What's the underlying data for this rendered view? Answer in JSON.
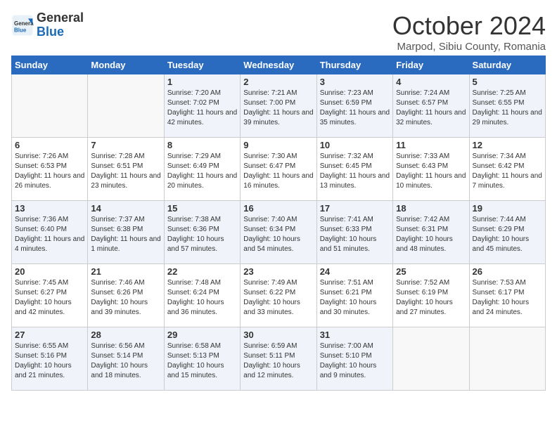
{
  "header": {
    "logo_general": "General",
    "logo_blue": "Blue",
    "month_title": "October 2024",
    "location": "Marpod, Sibiu County, Romania"
  },
  "days_of_week": [
    "Sunday",
    "Monday",
    "Tuesday",
    "Wednesday",
    "Thursday",
    "Friday",
    "Saturday"
  ],
  "weeks": [
    [
      {
        "day": "",
        "info": ""
      },
      {
        "day": "",
        "info": ""
      },
      {
        "day": "1",
        "info": "Sunrise: 7:20 AM\nSunset: 7:02 PM\nDaylight: 11 hours and 42 minutes."
      },
      {
        "day": "2",
        "info": "Sunrise: 7:21 AM\nSunset: 7:00 PM\nDaylight: 11 hours and 39 minutes."
      },
      {
        "day": "3",
        "info": "Sunrise: 7:23 AM\nSunset: 6:59 PM\nDaylight: 11 hours and 35 minutes."
      },
      {
        "day": "4",
        "info": "Sunrise: 7:24 AM\nSunset: 6:57 PM\nDaylight: 11 hours and 32 minutes."
      },
      {
        "day": "5",
        "info": "Sunrise: 7:25 AM\nSunset: 6:55 PM\nDaylight: 11 hours and 29 minutes."
      }
    ],
    [
      {
        "day": "6",
        "info": "Sunrise: 7:26 AM\nSunset: 6:53 PM\nDaylight: 11 hours and 26 minutes."
      },
      {
        "day": "7",
        "info": "Sunrise: 7:28 AM\nSunset: 6:51 PM\nDaylight: 11 hours and 23 minutes."
      },
      {
        "day": "8",
        "info": "Sunrise: 7:29 AM\nSunset: 6:49 PM\nDaylight: 11 hours and 20 minutes."
      },
      {
        "day": "9",
        "info": "Sunrise: 7:30 AM\nSunset: 6:47 PM\nDaylight: 11 hours and 16 minutes."
      },
      {
        "day": "10",
        "info": "Sunrise: 7:32 AM\nSunset: 6:45 PM\nDaylight: 11 hours and 13 minutes."
      },
      {
        "day": "11",
        "info": "Sunrise: 7:33 AM\nSunset: 6:43 PM\nDaylight: 11 hours and 10 minutes."
      },
      {
        "day": "12",
        "info": "Sunrise: 7:34 AM\nSunset: 6:42 PM\nDaylight: 11 hours and 7 minutes."
      }
    ],
    [
      {
        "day": "13",
        "info": "Sunrise: 7:36 AM\nSunset: 6:40 PM\nDaylight: 11 hours and 4 minutes."
      },
      {
        "day": "14",
        "info": "Sunrise: 7:37 AM\nSunset: 6:38 PM\nDaylight: 11 hours and 1 minute."
      },
      {
        "day": "15",
        "info": "Sunrise: 7:38 AM\nSunset: 6:36 PM\nDaylight: 10 hours and 57 minutes."
      },
      {
        "day": "16",
        "info": "Sunrise: 7:40 AM\nSunset: 6:34 PM\nDaylight: 10 hours and 54 minutes."
      },
      {
        "day": "17",
        "info": "Sunrise: 7:41 AM\nSunset: 6:33 PM\nDaylight: 10 hours and 51 minutes."
      },
      {
        "day": "18",
        "info": "Sunrise: 7:42 AM\nSunset: 6:31 PM\nDaylight: 10 hours and 48 minutes."
      },
      {
        "day": "19",
        "info": "Sunrise: 7:44 AM\nSunset: 6:29 PM\nDaylight: 10 hours and 45 minutes."
      }
    ],
    [
      {
        "day": "20",
        "info": "Sunrise: 7:45 AM\nSunset: 6:27 PM\nDaylight: 10 hours and 42 minutes."
      },
      {
        "day": "21",
        "info": "Sunrise: 7:46 AM\nSunset: 6:26 PM\nDaylight: 10 hours and 39 minutes."
      },
      {
        "day": "22",
        "info": "Sunrise: 7:48 AM\nSunset: 6:24 PM\nDaylight: 10 hours and 36 minutes."
      },
      {
        "day": "23",
        "info": "Sunrise: 7:49 AM\nSunset: 6:22 PM\nDaylight: 10 hours and 33 minutes."
      },
      {
        "day": "24",
        "info": "Sunrise: 7:51 AM\nSunset: 6:21 PM\nDaylight: 10 hours and 30 minutes."
      },
      {
        "day": "25",
        "info": "Sunrise: 7:52 AM\nSunset: 6:19 PM\nDaylight: 10 hours and 27 minutes."
      },
      {
        "day": "26",
        "info": "Sunrise: 7:53 AM\nSunset: 6:17 PM\nDaylight: 10 hours and 24 minutes."
      }
    ],
    [
      {
        "day": "27",
        "info": "Sunrise: 6:55 AM\nSunset: 5:16 PM\nDaylight: 10 hours and 21 minutes."
      },
      {
        "day": "28",
        "info": "Sunrise: 6:56 AM\nSunset: 5:14 PM\nDaylight: 10 hours and 18 minutes."
      },
      {
        "day": "29",
        "info": "Sunrise: 6:58 AM\nSunset: 5:13 PM\nDaylight: 10 hours and 15 minutes."
      },
      {
        "day": "30",
        "info": "Sunrise: 6:59 AM\nSunset: 5:11 PM\nDaylight: 10 hours and 12 minutes."
      },
      {
        "day": "31",
        "info": "Sunrise: 7:00 AM\nSunset: 5:10 PM\nDaylight: 10 hours and 9 minutes."
      },
      {
        "day": "",
        "info": ""
      },
      {
        "day": "",
        "info": ""
      }
    ]
  ]
}
